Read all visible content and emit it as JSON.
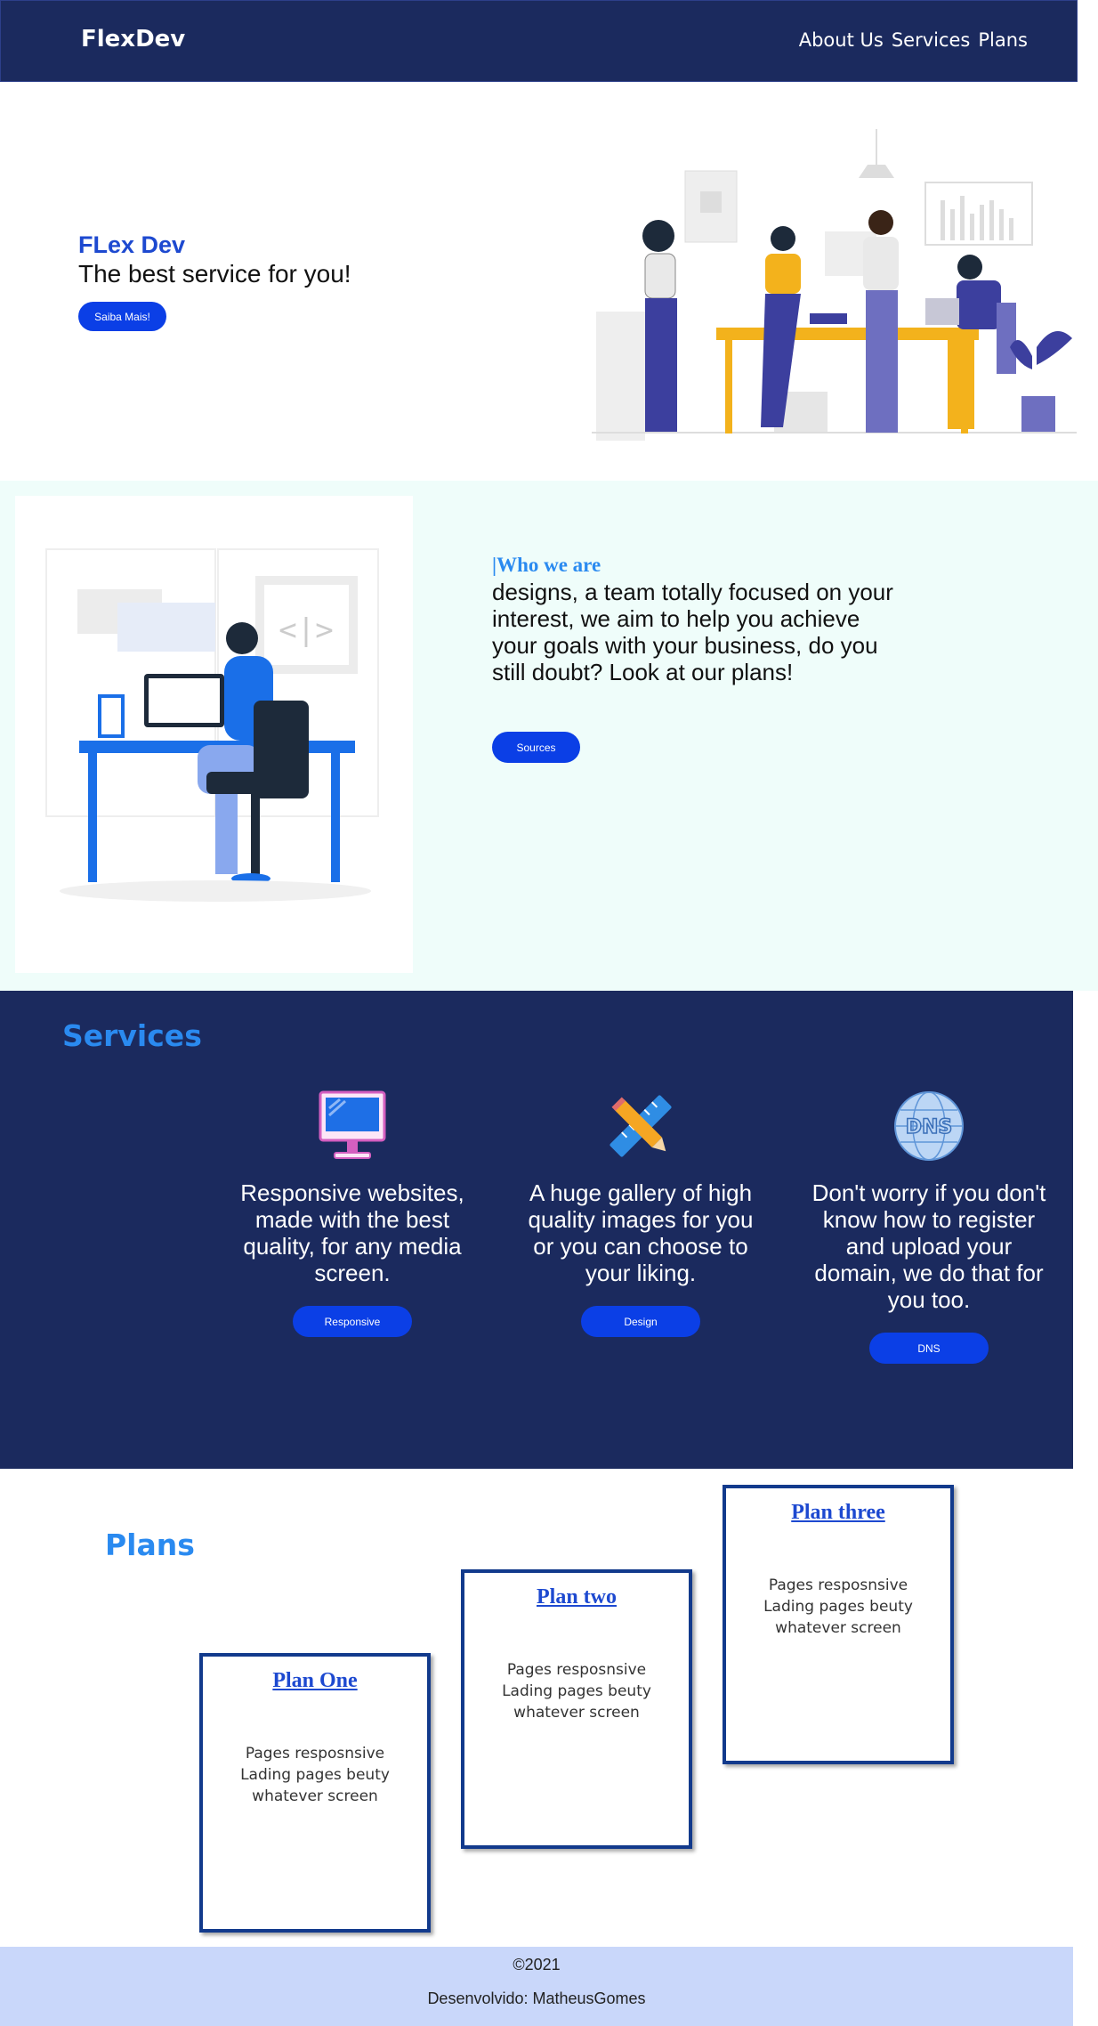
{
  "nav": {
    "brand": "FlexDev",
    "links": [
      "About Us",
      "Services",
      "Plans"
    ]
  },
  "hero": {
    "brand": "FLex Dev",
    "tagline": "The best service for you!",
    "button": "Saiba Mais!"
  },
  "who": {
    "title": "|Who we are",
    "text": "designs, a team totally focused on your interest, we aim to help you achieve your goals with your business, do you still doubt? Look at our plans!",
    "button": "Sources"
  },
  "services": {
    "title": "Services",
    "items": [
      {
        "icon": "monitor-icon",
        "text": "Responsive websites, made with the best quality, for any media screen.",
        "button": "Responsive"
      },
      {
        "icon": "ruler-pencil-icon",
        "text": "A huge gallery of high quality images for you or you can choose to your liking.",
        "button": "Design"
      },
      {
        "icon": "dns-globe-icon",
        "text": "Don't worry if you don't know how to register and upload your domain, we do that for you too.",
        "button": "DNS"
      }
    ]
  },
  "plans": {
    "title": "Plans",
    "items": [
      {
        "name": "Plan One",
        "lines": [
          "Pages resposnsive",
          "Lading pages beuty",
          "whatever screen"
        ]
      },
      {
        "name": "Plan two",
        "lines": [
          "Pages resposnsive",
          "Lading pages beuty",
          "whatever screen"
        ]
      },
      {
        "name": "Plan three",
        "lines": [
          "Pages resposnsive",
          "Lading pages beuty",
          "whatever screen"
        ]
      }
    ]
  },
  "footer": {
    "copyright": "©2021",
    "developer": "Desenvolvido: MatheusGomes"
  },
  "colors": {
    "navy": "#1b2a5e",
    "accent_blue": "#2a8af0",
    "button_blue": "#0b3fe6",
    "mint": "#effdfa",
    "footer": "#c9d7fa"
  }
}
